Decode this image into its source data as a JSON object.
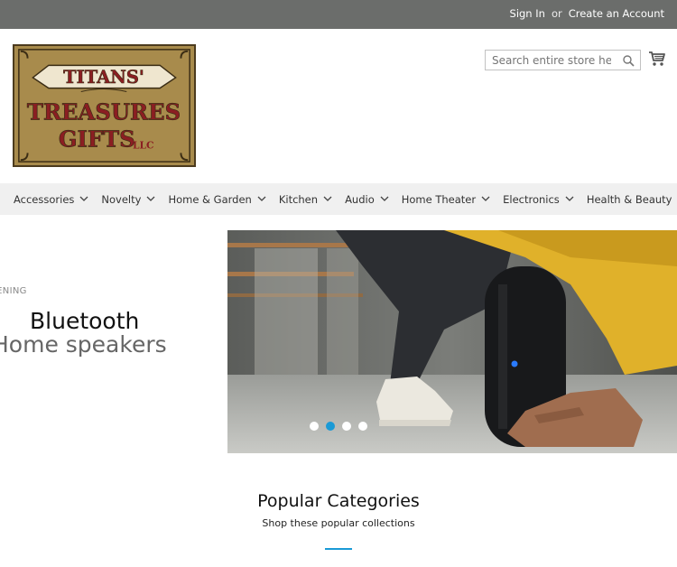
{
  "header": {
    "sign_in": "Sign In",
    "or": "or",
    "create_account": "Create an Account"
  },
  "logo": {
    "line1": "TITANS'",
    "line2": "TREASURES",
    "line3": "GIFTS",
    "suffix": "LLC"
  },
  "search": {
    "placeholder": "Search entire store here..."
  },
  "nav": {
    "items": [
      "Accessories",
      "Novelty",
      "Home & Garden",
      "Kitchen",
      "Audio",
      "Home Theater",
      "Electronics",
      "Health & Beauty"
    ]
  },
  "hero": {
    "eyebrow": "LISTENING",
    "title_line1": "Bluetooth",
    "title_line2": "Home speakers",
    "slide_count": 4,
    "active_slide": 2
  },
  "categories": {
    "title": "Popular Categories",
    "subtitle": "Shop these popular collections"
  },
  "colors": {
    "topbar": "#6b6d6b",
    "accent": "#1a9ad6",
    "nav_bg": "#f0f0f0",
    "logo_bg": "#a88b4c",
    "logo_text": "#8b1e22"
  }
}
